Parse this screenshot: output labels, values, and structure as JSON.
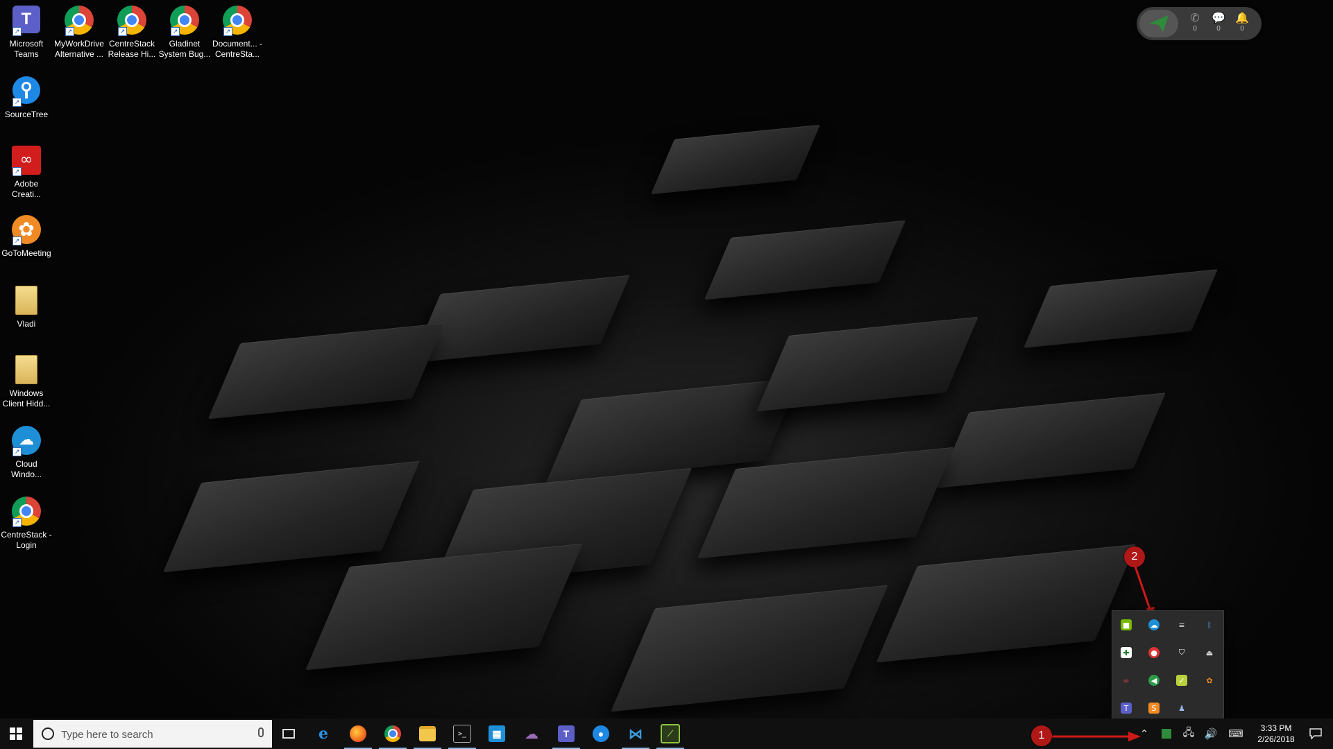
{
  "desktop": {
    "icons": [
      {
        "label": "Microsoft Teams",
        "icon": "teams-icon",
        "color": "#5b5fc7"
      },
      {
        "label": "MyWorkDrive Alternative ...",
        "icon": "chrome-icon"
      },
      {
        "label": "CentreStack Release Hi...",
        "icon": "chrome-icon"
      },
      {
        "label": "Gladinet System Bug...",
        "icon": "chrome-icon"
      },
      {
        "label": "Document... - CentreSta...",
        "icon": "chrome-icon"
      },
      {
        "label": "SourceTree",
        "icon": "sourcetree-icon",
        "color": "#1e88e5"
      },
      {
        "label": "Adobe Creati...",
        "icon": "adobe-creative-cloud-icon",
        "color": "#d21d1d"
      },
      {
        "label": "GoToMeeting",
        "icon": "gotomeeting-icon",
        "color": "#f08a24"
      },
      {
        "label": "Vladi",
        "icon": "folder-icon",
        "color": "#e8c66b"
      },
      {
        "label": "Windows Client Hidd...",
        "icon": "folder-icon",
        "color": "#e8c66b"
      },
      {
        "label": "Cloud Windo...",
        "icon": "cloud-icon",
        "color": "#1e8fd6"
      },
      {
        "label": "CentreStack - Login",
        "icon": "chrome-icon"
      }
    ]
  },
  "phone_widget": {
    "calls_count": "0",
    "messages_count": "0",
    "notifications_count": "0"
  },
  "annotations": {
    "marker_1": "1",
    "marker_2": "2"
  },
  "taskbar": {
    "search_placeholder": "Type here to search",
    "apps": [
      {
        "icon": "task-view-icon",
        "running": false
      },
      {
        "icon": "edge-icon",
        "running": false
      },
      {
        "icon": "firefox-icon",
        "running": true
      },
      {
        "icon": "chrome-icon",
        "running": true
      },
      {
        "icon": "file-explorer-icon",
        "running": true
      },
      {
        "icon": "command-prompt-icon",
        "running": true
      },
      {
        "icon": "store-icon",
        "running": false
      },
      {
        "icon": "onedrive-business-icon",
        "running": false
      },
      {
        "icon": "teams-icon",
        "running": true
      },
      {
        "icon": "sourcetree-icon",
        "running": false
      },
      {
        "icon": "vscode-icon",
        "running": true
      },
      {
        "icon": "dev-tool-icon",
        "running": true
      }
    ],
    "clock_time": "3:33 PM",
    "clock_date": "2/26/2018"
  },
  "tray_flyout": {
    "icons": [
      "nvidia-icon",
      "cloud-sync-icon",
      "media-icon",
      "bluetooth-icon",
      "defender-icon",
      "chrome-red-icon",
      "shield-icon",
      "usb-eject-icon",
      "cc-icon",
      "sync-green-icon",
      "clipboard-icon",
      "gotomeeting-tray-icon",
      "teams-tray-icon",
      "sublime-icon",
      "user-icon"
    ]
  }
}
